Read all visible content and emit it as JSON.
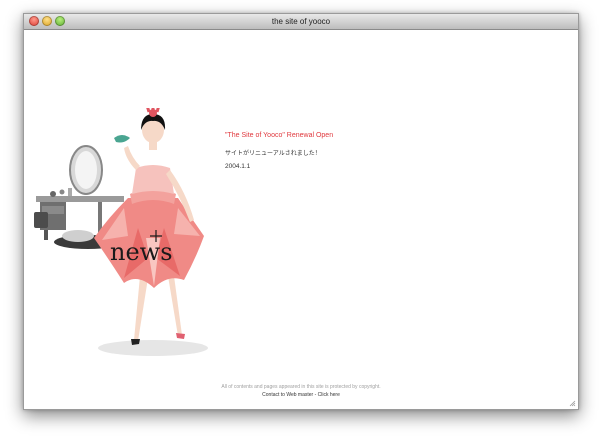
{
  "window": {
    "title": "the site of yooco"
  },
  "news": {
    "headline": "\"The Site of Yooco\" Renewal Open",
    "body": "サイトがリニューアルされました！",
    "date": "2004.1.1",
    "illustration_text": "news"
  },
  "footer": {
    "copyright": "All of contents and pages appeared in this site is protected by copyright.",
    "contact": "Contact to Web master - Click here"
  },
  "colors": {
    "headline": "#e0393e",
    "text": "#333333",
    "footer_muted": "#a0a0a0",
    "dress_pink": "#f08a86"
  },
  "icons": {
    "close": "close-button",
    "minimize": "minimize-button",
    "zoom": "zoom-button",
    "resize": "resize-grip-icon"
  }
}
